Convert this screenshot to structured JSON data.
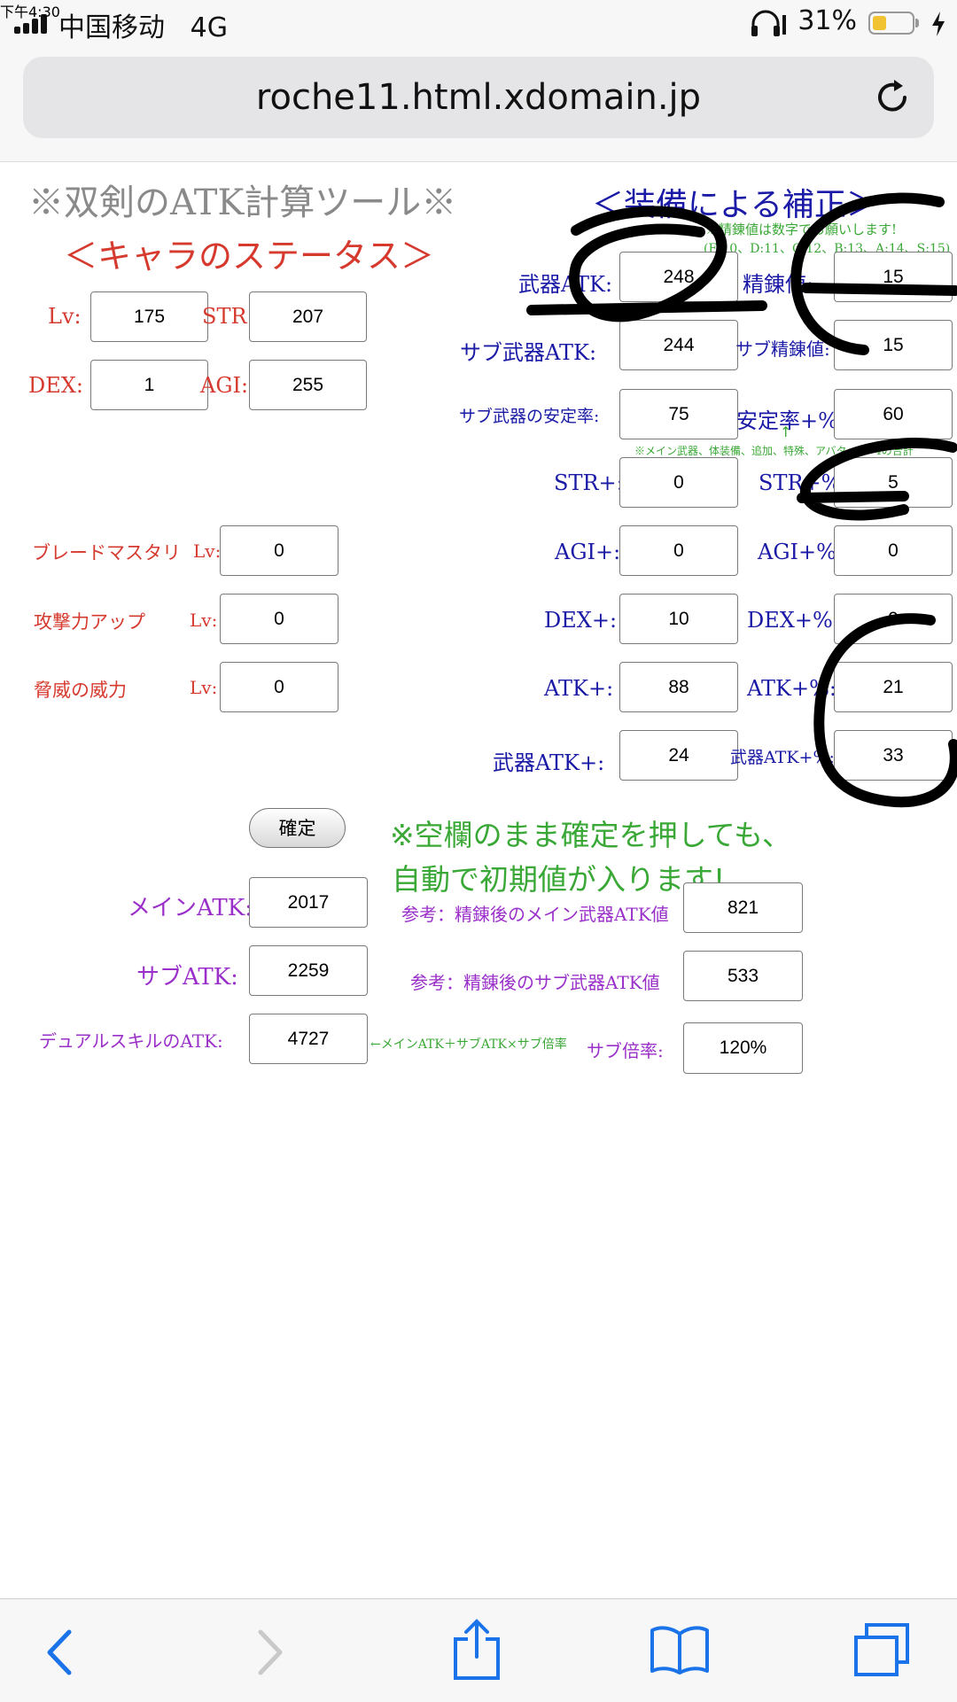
{
  "status_bar": {
    "carrier": "中国移动",
    "network": "4G",
    "time": "下午4:30",
    "battery": "31%"
  },
  "browser": {
    "url": "roche11.html.xdomain.jp"
  },
  "page": {
    "title": "※双剣のATK計算ツール※",
    "char_section": "＜キャラのステータス＞",
    "equip_section": "＜装備による補正＞",
    "refine_note": "※精錬値は数字でお願いします!",
    "refine_note2": "(E:10、D:11、C:12、B:13、A:14、S:15)",
    "sum_note": "※メイン武器、体装備、追加、特殊、アバター2〜4の合計",
    "arrow_up": "↑",
    "blank_note_line1": "※空欄のまま確定を押しても、",
    "blank_note_line2": "自動で初期値が入ります!",
    "formula_note": "←メインATK＋サブATK×サブ倍率",
    "confirm_button": "確定"
  },
  "char_stats": {
    "lv_label": "Lv:",
    "lv": "175",
    "str_label": "STR:",
    "str": "207",
    "dex_label": "DEX:",
    "dex": "1",
    "agi_label": "AGI:",
    "agi": "255"
  },
  "skills": [
    {
      "label": "ブレードマスタリ",
      "lv_label": "Lv:",
      "value": "0"
    },
    {
      "label": "攻撃力アップ",
      "lv_label": "Lv:",
      "value": "0"
    },
    {
      "label": "脅威の威力",
      "lv_label": "Lv:",
      "value": "0"
    }
  ],
  "equip": {
    "weapon_atk_label": "武器ATK:",
    "weapon_atk": "248",
    "refine_label": "精錬値:",
    "refine": "15",
    "sub_weapon_atk_label": "サブ武器ATK:",
    "sub_weapon_atk": "244",
    "sub_refine_label": "サブ精錬値:",
    "sub_refine": "15",
    "sub_stability_label": "サブ武器の安定率:",
    "sub_stability": "75",
    "stability_plus_label": "安定率+%:",
    "stability_plus": "60",
    "str_plus_label": "STR+:",
    "str_plus": "0",
    "str_pct_label": "STR+%:",
    "str_pct": "5",
    "agi_plus_label": "AGI+:",
    "agi_plus": "0",
    "agi_pct_label": "AGI+%:",
    "agi_pct": "0",
    "dex_plus_label": "DEX+:",
    "dex_plus": "10",
    "dex_pct_label": "DEX+%:",
    "dex_pct": "0",
    "atk_plus_label": "ATK+:",
    "atk_plus": "88",
    "atk_pct_label": "ATK+%:",
    "atk_pct": "21",
    "weapon_atk_plus_label": "武器ATK+:",
    "weapon_atk_plus": "24",
    "weapon_atk_pct_label": "武器ATK+%:",
    "weapon_atk_pct": "33"
  },
  "results": {
    "main_atk_label": "メインATK:",
    "main_atk": "2017",
    "sub_atk_label": "サブATK:",
    "sub_atk": "2259",
    "dual_atk_label": "デュアルスキルのATK:",
    "dual_atk": "4727",
    "ref_main_label": "参考：精錬後のメイン武器ATK値",
    "ref_main": "821",
    "ref_sub_label": "参考：精錬後のサブ武器ATK値",
    "ref_sub": "533",
    "sub_ratio_label": "サブ倍率:",
    "sub_ratio": "120%"
  },
  "colors": {
    "char_label": "#d63a2f",
    "equip_label": "#1a1aa6",
    "result_label": "#9a30c9",
    "note": "#3aa836"
  }
}
